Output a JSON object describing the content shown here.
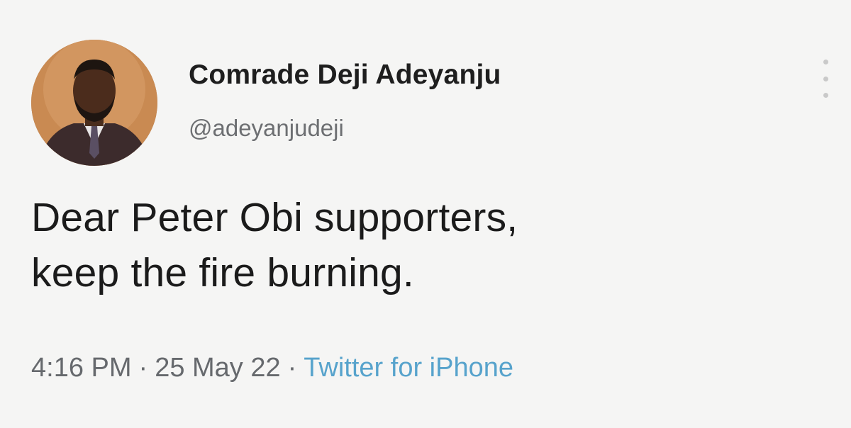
{
  "tweet": {
    "author": {
      "display_name": "Comrade Deji Adeyanju",
      "handle": "@adeyanjudeji"
    },
    "text_line1": "Dear Peter Obi supporters,",
    "text_line2": "keep the fire burning.",
    "time": "4:16 PM",
    "date": "25 May 22",
    "separator": "·",
    "source": "Twitter for iPhone",
    "more_icon": "vertical-ellipsis-icon",
    "colors": {
      "background": "#f5f5f4",
      "text": "#1b1b1b",
      "muted": "#66696d",
      "source_link": "#57a3cc"
    }
  }
}
